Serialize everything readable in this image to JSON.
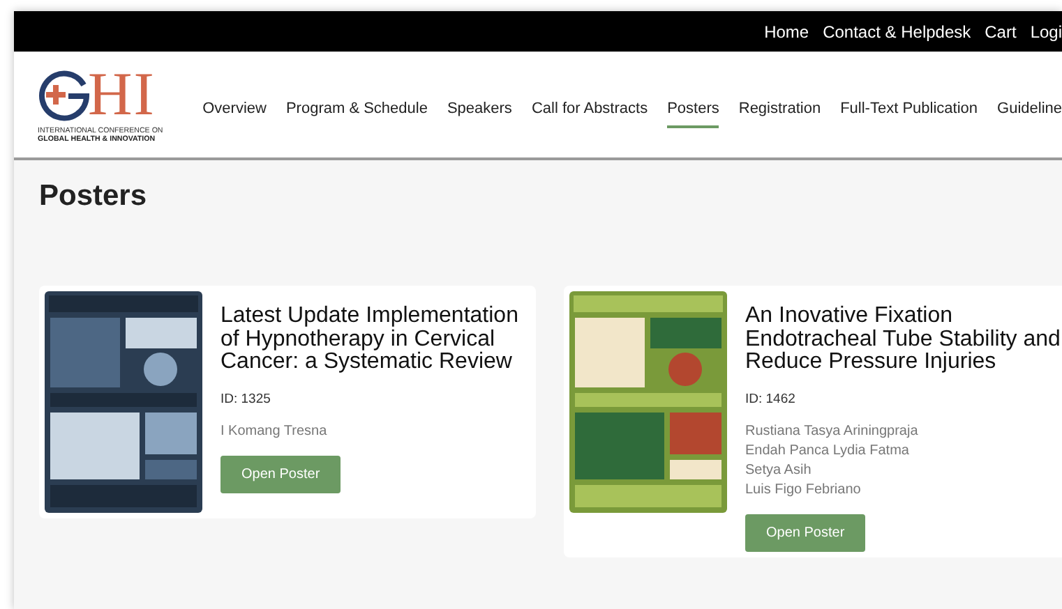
{
  "top_links": [
    {
      "label": "Home"
    },
    {
      "label": "Contact & Helpdesk"
    },
    {
      "label": "Cart"
    },
    {
      "label": "Logi"
    }
  ],
  "logo": {
    "letters": "HI",
    "line1": "INTERNATIONAL CONFERENCE ON",
    "line2": "GLOBAL HEALTH & INNOVATION"
  },
  "nav": [
    {
      "label": "Overview",
      "selected": false
    },
    {
      "label": "Program & Schedule",
      "selected": false
    },
    {
      "label": "Speakers",
      "selected": false
    },
    {
      "label": "Call for Abstracts",
      "selected": false
    },
    {
      "label": "Posters",
      "selected": true
    },
    {
      "label": "Registration",
      "selected": false
    },
    {
      "label": "Full-Text Publication",
      "selected": false
    },
    {
      "label": "Guideline",
      "selected": false
    }
  ],
  "page_title": "Posters",
  "posters": [
    {
      "thumbnail": {
        "kind": "picture"
      },
      "title": "Latest Update Implementation of Hypnotherapy in Cervical Cancer: a Systematic Review",
      "id": "ID: 1325",
      "authors": [
        "I Komang Tresna"
      ],
      "button": "Open Poster"
    },
    {
      "thumbnail": {
        "kind": "picture"
      },
      "title": "An Inovative Fixation Endotracheal Tube Stability and Reduce Pressure Injuries",
      "id": "ID: 1462",
      "authors": [
        "Rustiana Tasya Ariningpraja",
        "Endah Panca Lydia Fatma",
        "Setya Asih",
        "Luis Figo Febriano"
      ],
      "button": "Open Poster"
    }
  ]
}
